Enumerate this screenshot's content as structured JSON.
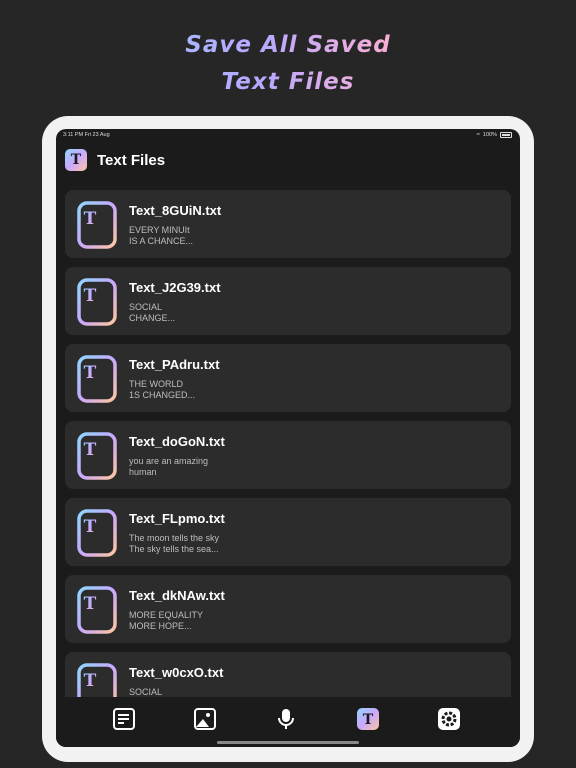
{
  "promo": {
    "line1": "Save All Saved",
    "line2": "Text Files"
  },
  "status_bar": {
    "time": "3:11 PM  Fri 23 Aug",
    "wifi": "wifi-icon",
    "battery": "100%"
  },
  "header": {
    "app_icon_letter": "T",
    "title": "Text Files"
  },
  "files": [
    {
      "name": "Text_8GUiN.txt",
      "preview": "EVERY MINUIt\nIS A CHANCE..."
    },
    {
      "name": "Text_J2G39.txt",
      "preview": "SOCIAL\nCHANGE..."
    },
    {
      "name": "Text_PAdru.txt",
      "preview": "THE WORLD\n1S CHANGED..."
    },
    {
      "name": "Text_doGoN.txt",
      "preview": "you are an amazing\nhuman"
    },
    {
      "name": "Text_FLpmo.txt",
      "preview": "The moon tells the sky\nThe sky tells the sea..."
    },
    {
      "name": "Text_dkNAw.txt",
      "preview": "MORE EQUALITY\nMORE HOPE..."
    },
    {
      "name": "Text_w0cxO.txt",
      "preview": "SOCIAL"
    }
  ],
  "tabs": [
    {
      "icon": "notes-icon"
    },
    {
      "icon": "image-icon"
    },
    {
      "icon": "microphone-icon"
    },
    {
      "icon": "text-files-icon",
      "active": true
    },
    {
      "icon": "gear-icon"
    }
  ],
  "colors": {
    "background": "#262626",
    "card": "#2c2c2c",
    "screen": "#1b1b1b",
    "gradient": [
      "#8fd6ff",
      "#c9a8ff",
      "#ffc6a0"
    ]
  }
}
